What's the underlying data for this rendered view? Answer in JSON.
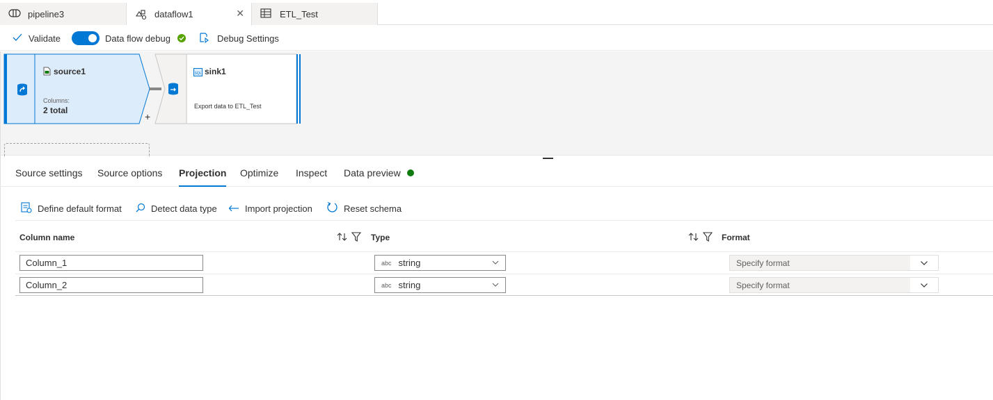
{
  "tabs": [
    {
      "label": "pipeline3",
      "icon": "pipeline-icon"
    },
    {
      "label": "dataflow1",
      "icon": "dataflow-icon",
      "active": true,
      "closable": true
    },
    {
      "label": "ETL_Test",
      "icon": "table-icon"
    }
  ],
  "toolbar": {
    "validate_label": "Validate",
    "debug_label": "Data flow debug",
    "debug_on": true,
    "debug_settings_label": "Debug Settings"
  },
  "canvas": {
    "source": {
      "name": "source1",
      "columns_label": "Columns:",
      "columns_value": "2 total"
    },
    "sink": {
      "name": "sink1",
      "description": "Export data to ETL_Test"
    },
    "add_symbol": "+"
  },
  "detail_tabs": [
    {
      "label": "Source settings"
    },
    {
      "label": "Source options"
    },
    {
      "label": "Projection",
      "active": true
    },
    {
      "label": "Optimize"
    },
    {
      "label": "Inspect"
    },
    {
      "label": "Data preview",
      "status_dot": true
    }
  ],
  "projection_toolbar": {
    "define_default_format": "Define default format",
    "detect_data_type": "Detect data type",
    "import_projection": "Import projection",
    "reset_schema": "Reset schema"
  },
  "table": {
    "headers": {
      "column_name": "Column name",
      "type": "Type",
      "format": "Format"
    },
    "rows": [
      {
        "column_name": "Column_1",
        "type_badge": "abc",
        "type": "string",
        "format_placeholder": "Specify format"
      },
      {
        "column_name": "Column_2",
        "type_badge": "abc",
        "type": "string",
        "format_placeholder": "Specify format"
      }
    ]
  },
  "colors": {
    "accent": "#0078d4",
    "success": "#57a300",
    "preview_dot": "#107c10"
  }
}
